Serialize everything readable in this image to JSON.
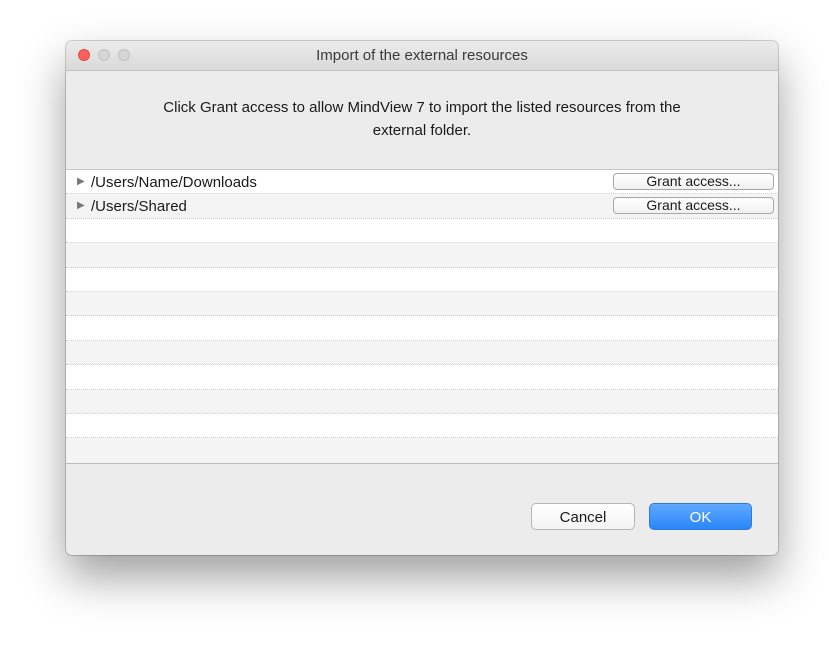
{
  "window": {
    "title": "Import of the external resources"
  },
  "instructions": {
    "line1": "Click Grant access to allow MindView 7 to import the listed resources from the",
    "line2": "external folder."
  },
  "resources": [
    {
      "path": "/Users/Name/Downloads",
      "button_label": "Grant access..."
    },
    {
      "path": "/Users/Shared",
      "button_label": "Grant access..."
    }
  ],
  "footer": {
    "cancel_label": "Cancel",
    "ok_label": "OK"
  },
  "colors": {
    "close_button": "#fc605c",
    "primary_button": "#2a86f8",
    "window_background": "#ececec"
  },
  "icons": {
    "disclosure": "disclosure-triangle-right-icon"
  }
}
